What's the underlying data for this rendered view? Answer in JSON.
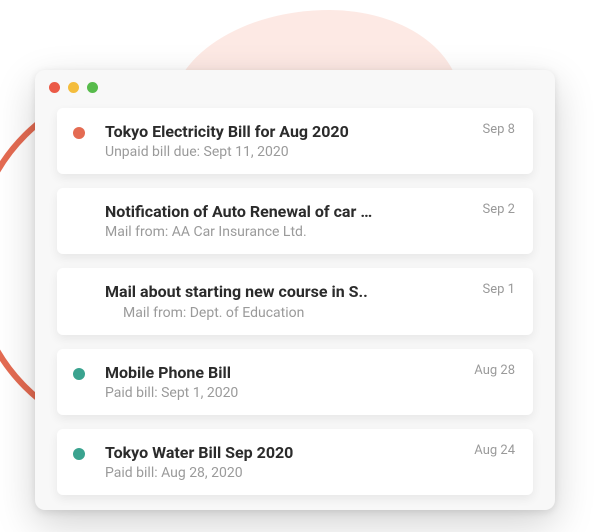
{
  "colors": {
    "status_unpaid": "#e46b52",
    "status_paid": "#3aa38f",
    "bg_subtle": "#fde9e4"
  },
  "items": [
    {
      "status": "unpaid",
      "title": "Tokyo Electricity Bill for Aug 2020",
      "subtitle": "Unpaid bill due: Sept 11, 2020",
      "indent": false,
      "date": "Sep 8"
    },
    {
      "status": "none",
      "title": "Notification of Auto Renewal of car …",
      "subtitle": "Mail from: AA Car Insurance Ltd.",
      "indent": false,
      "date": "Sep 2"
    },
    {
      "status": "none",
      "title": "Mail about starting new course in S..",
      "subtitle": "Mail from: Dept. of Education",
      "indent": true,
      "date": "Sep 1"
    },
    {
      "status": "paid",
      "title": "Mobile Phone Bill",
      "subtitle": "Paid bill: Sept 1, 2020",
      "indent": false,
      "date": "Aug 28"
    },
    {
      "status": "paid",
      "title": "Tokyo Water Bill Sep 2020",
      "subtitle": "Paid bill: Aug 28, 2020",
      "indent": false,
      "date": "Aug 24"
    }
  ]
}
